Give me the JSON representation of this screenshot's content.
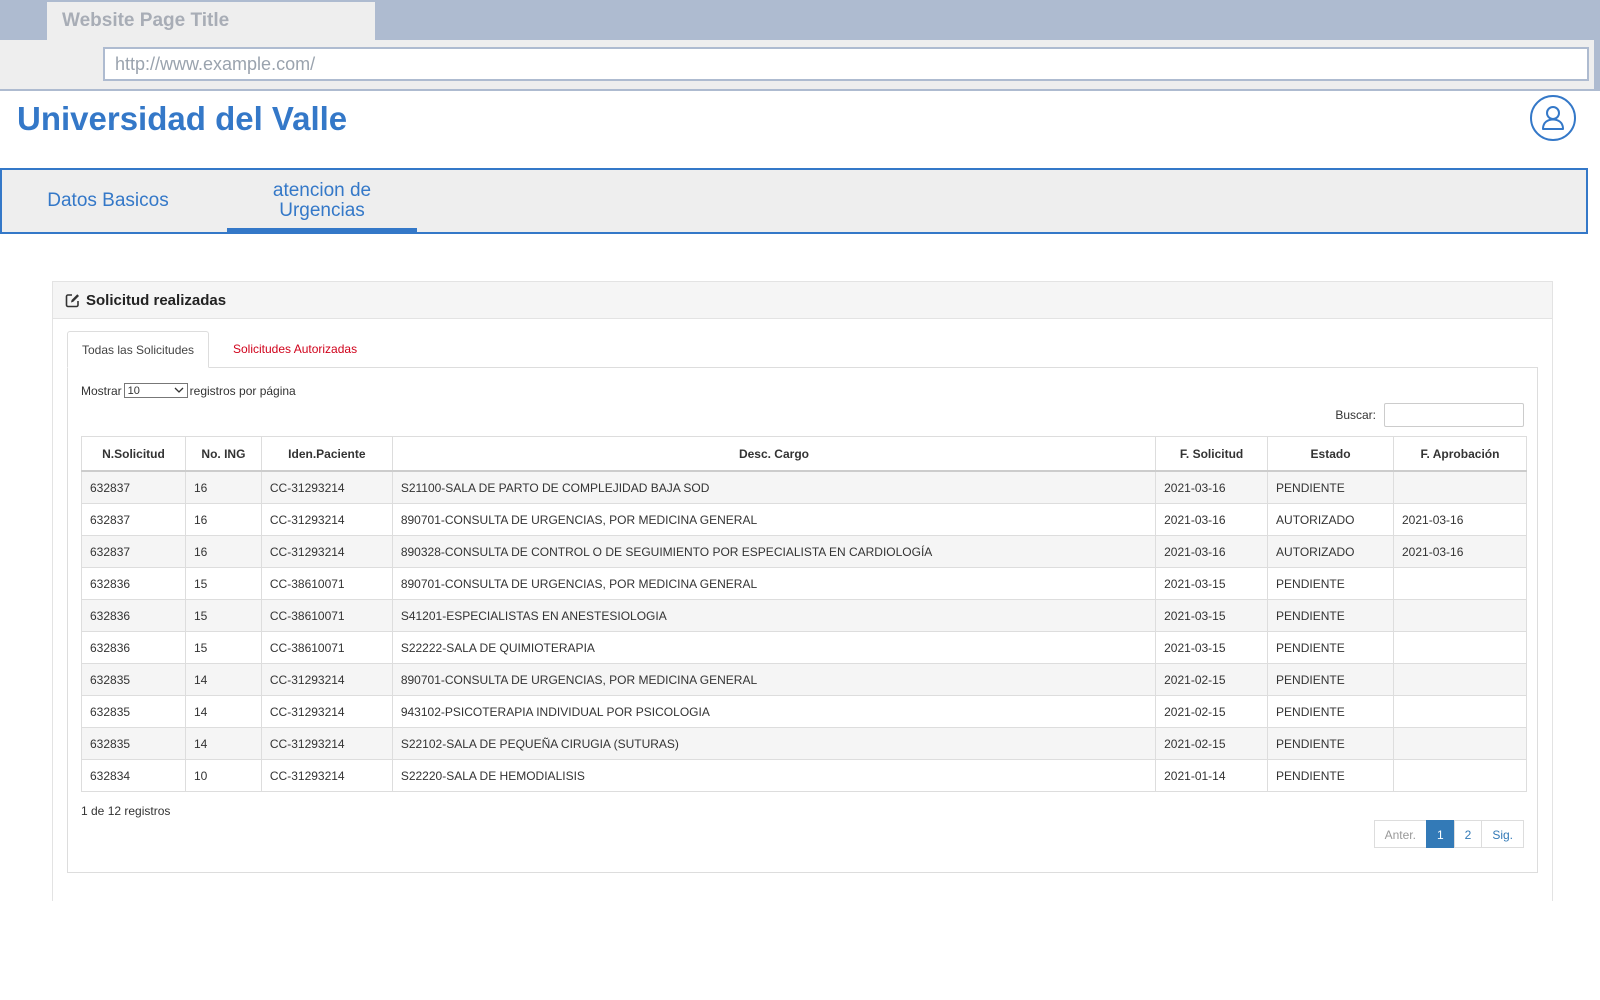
{
  "browser": {
    "tab_title": "Website Page Title",
    "url": "http://www.example.com/"
  },
  "header": {
    "title": "Universidad del Valle",
    "user_icon": "user-icon"
  },
  "nav": {
    "tabs": [
      {
        "label": "Datos Basicos",
        "active": false
      },
      {
        "label_line1": "atencion de",
        "label_line2": "Urgencias",
        "active": true
      }
    ]
  },
  "panel": {
    "icon": "edit-icon",
    "title": "Solicitud realizadas",
    "subtabs": [
      {
        "label": "Todas las Solicitudes",
        "active": true
      },
      {
        "label": "Solicitudes Autorizadas",
        "active": false
      }
    ],
    "length": {
      "prefix": "Mostrar",
      "value": "10",
      "suffix": "registros por página"
    },
    "search": {
      "label": "Buscar:",
      "value": ""
    },
    "table": {
      "columns": [
        "N.Solicitud",
        "No. ING",
        "Iden.Paciente",
        "Desc. Cargo",
        "F. Solicitud",
        "Estado",
        "F. Aprobación"
      ],
      "rows": [
        [
          "632837",
          "16",
          "CC-31293214",
          "S21100-SALA DE PARTO DE COMPLEJIDAD BAJA SOD",
          "2021-03-16",
          "PENDIENTE",
          ""
        ],
        [
          "632837",
          "16",
          "CC-31293214",
          "890701-CONSULTA DE URGENCIAS, POR MEDICINA GENERAL",
          "2021-03-16",
          "AUTORIZADO",
          "2021-03-16"
        ],
        [
          "632837",
          "16",
          "CC-31293214",
          "890328-CONSULTA DE CONTROL O DE SEGUIMIENTO POR ESPECIALISTA EN CARDIOLOGÍA",
          "2021-03-16",
          "AUTORIZADO",
          "2021-03-16"
        ],
        [
          "632836",
          "15",
          "CC-38610071",
          "890701-CONSULTA DE URGENCIAS, POR MEDICINA GENERAL",
          "2021-03-15",
          "PENDIENTE",
          ""
        ],
        [
          "632836",
          "15",
          "CC-38610071",
          "S41201-ESPECIALISTAS EN ANESTESIOLOGIA",
          "2021-03-15",
          "PENDIENTE",
          ""
        ],
        [
          "632836",
          "15",
          "CC-38610071",
          "S22222-SALA DE QUIMIOTERAPIA",
          "2021-03-15",
          "PENDIENTE",
          ""
        ],
        [
          "632835",
          "14",
          "CC-31293214",
          "890701-CONSULTA DE URGENCIAS, POR MEDICINA GENERAL",
          "2021-02-15",
          "PENDIENTE",
          ""
        ],
        [
          "632835",
          "14",
          "CC-31293214",
          "943102-PSICOTERAPIA INDIVIDUAL POR PSICOLOGIA",
          "2021-02-15",
          "PENDIENTE",
          ""
        ],
        [
          "632835",
          "14",
          "CC-31293214",
          "S22102-SALA DE PEQUEÑA CIRUGIA (SUTURAS)",
          "2021-02-15",
          "PENDIENTE",
          ""
        ],
        [
          "632834",
          "10",
          "CC-31293214",
          "S22220-SALA DE HEMODIALISIS",
          "2021-01-14",
          "PENDIENTE",
          ""
        ]
      ]
    },
    "info": "1 de 12 registros",
    "pagination": {
      "prev": "Anter.",
      "pages": [
        "1",
        "2"
      ],
      "current": "1",
      "next": "Sig."
    }
  },
  "colors": {
    "brand": "#3478c8",
    "chrome": "#aebbd0",
    "alert_tab": "#d0021b",
    "pager_active": "#337ab7"
  }
}
